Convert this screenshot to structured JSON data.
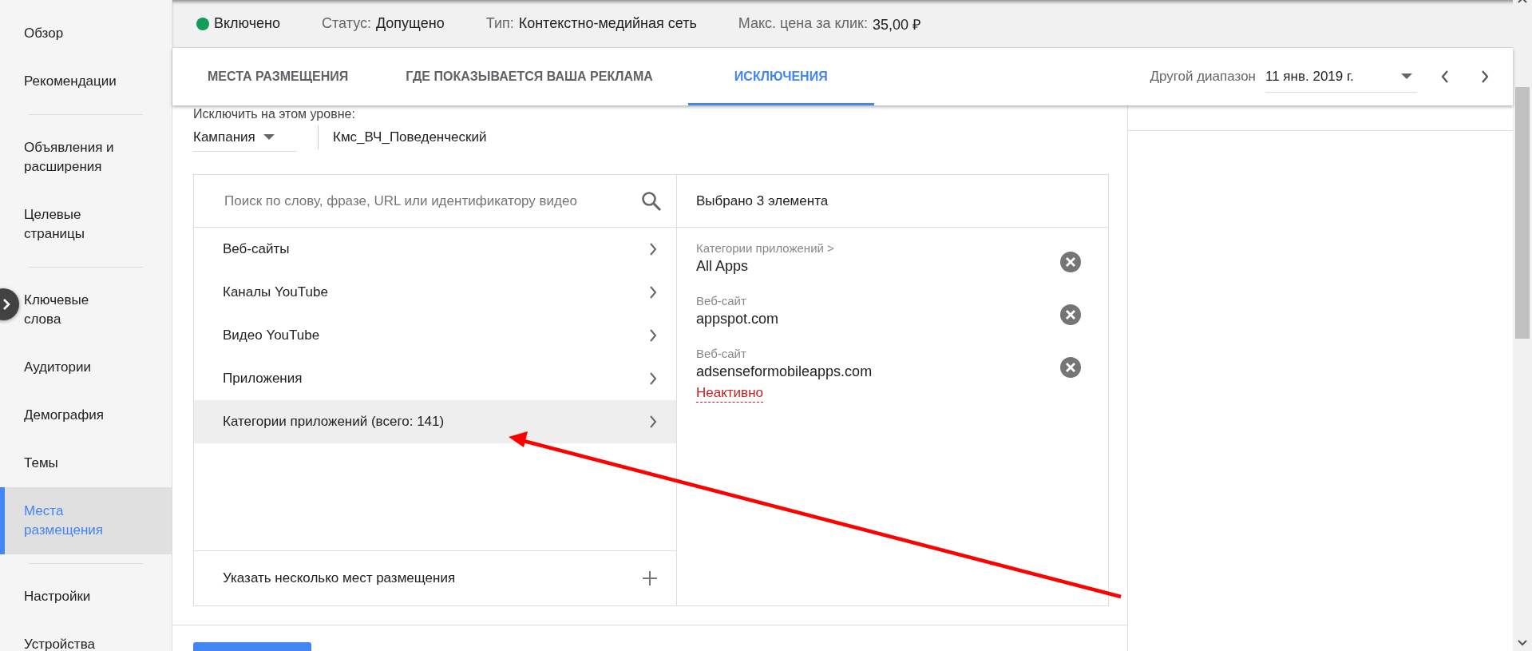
{
  "sidebar": {
    "groups": [
      [
        {
          "label": "Обзор",
          "selected": false
        },
        {
          "label": "Рекомендации",
          "selected": false
        }
      ],
      [
        {
          "label": "Объявления и\nрасширения",
          "selected": false
        },
        {
          "label": "Целевые\nстраницы",
          "selected": false
        }
      ],
      [
        {
          "label": "Ключевые\nслова",
          "selected": false
        },
        {
          "label": "Аудитории",
          "selected": false
        },
        {
          "label": "Демография",
          "selected": false
        },
        {
          "label": "Темы",
          "selected": false
        },
        {
          "label": "Места\nразмещения",
          "selected": true
        }
      ],
      [
        {
          "label": "Настройки",
          "selected": false
        },
        {
          "label": "Устройства",
          "selected": false
        }
      ]
    ]
  },
  "status_bar": {
    "state": {
      "label": "Включено",
      "on": true
    },
    "fields": [
      {
        "label": "Статус:",
        "value": "Допущено"
      },
      {
        "label": "Тип:",
        "value": "Контекстно-медийная сеть"
      },
      {
        "label": "Макс. цена за клик:",
        "value": "35,00 ₽"
      }
    ]
  },
  "tabs": [
    {
      "label": "МЕСТА РАЗМЕЩЕНИЯ",
      "selected": false
    },
    {
      "label": "ГДЕ ПОКАЗЫВАЕТСЯ ВАША РЕКЛАМА",
      "selected": false
    },
    {
      "label": "ИСКЛЮЧЕНИЯ",
      "selected": true
    }
  ],
  "date_range": {
    "label": "Другой диапазон",
    "value": "11 янв. 2019 г."
  },
  "exclusion_level": {
    "label": "Исключить на этом уровне:",
    "level": "Кампания",
    "campaign": "Кмс_ВЧ_Поведенческий"
  },
  "browser": {
    "search": {
      "placeholder": "Поиск по слову, фразе, URL или идентификатору видео"
    },
    "categories": [
      {
        "label": "Веб-сайты",
        "selected": false
      },
      {
        "label": "Каналы YouTube",
        "selected": false
      },
      {
        "label": "Видео YouTube",
        "selected": false
      },
      {
        "label": "Приложения",
        "selected": false
      },
      {
        "label": "Категории приложений (всего: 141)",
        "selected": true
      }
    ],
    "add_multiple": "Указать несколько мест размещения"
  },
  "selected_panel": {
    "header": "Выбрано 3 элемента",
    "items": [
      {
        "type": "Категории приложений >",
        "value": "All Apps"
      },
      {
        "type": "Веб-сайт",
        "value": "appspot.com"
      },
      {
        "type": "Веб-сайт",
        "value": "adsenseformobileapps.com",
        "status": "Неактивно"
      }
    ]
  }
}
